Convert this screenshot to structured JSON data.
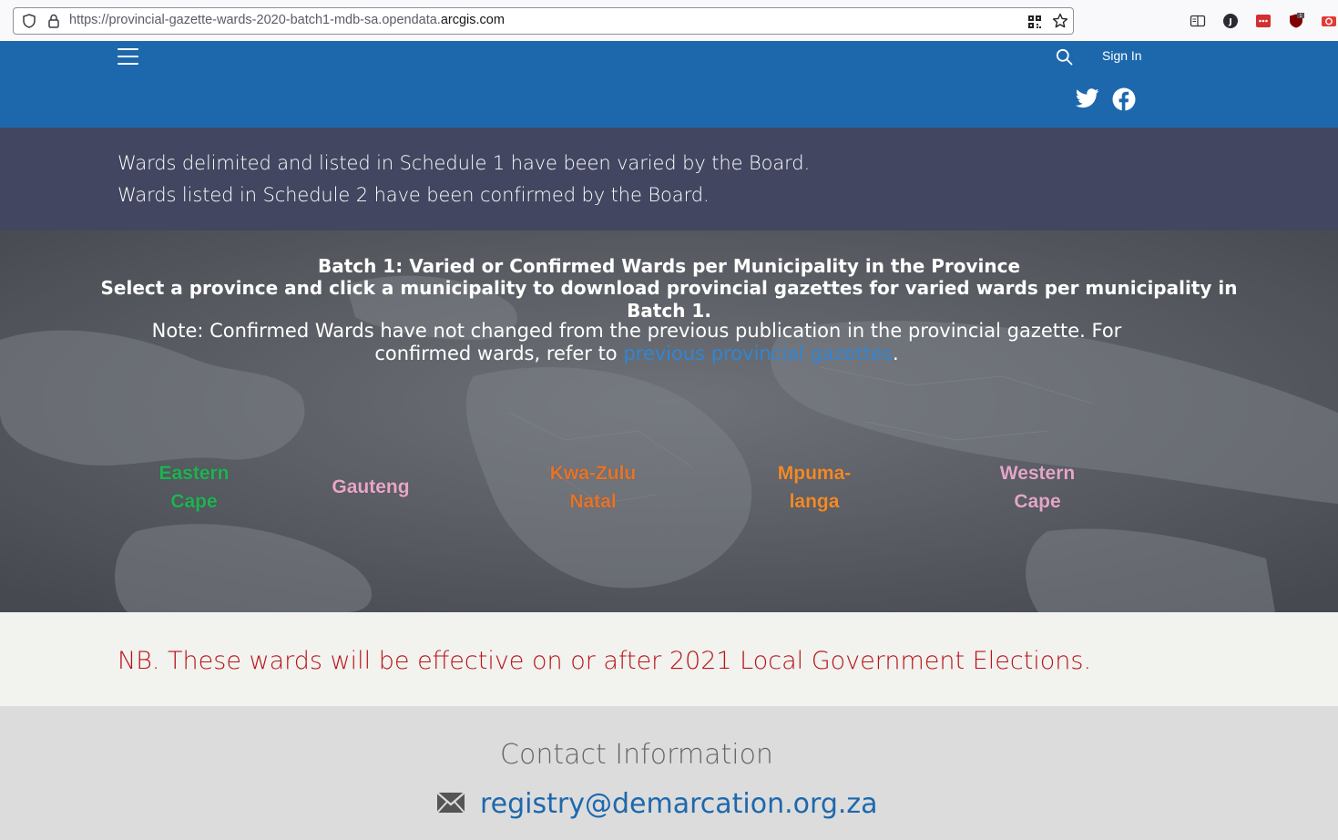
{
  "browser": {
    "url_prefix": "https://provincial-gazette-wards-2020-batch1-mdb-sa.opendata.",
    "url_domain": "arcgis.com"
  },
  "header": {
    "signin_label": "Sign In"
  },
  "info": {
    "line1": "Wards delimited and listed in Schedule 1 have been varied by the Board.",
    "line2": "Wards listed in Schedule 2 have been confirmed by the Board."
  },
  "map_section": {
    "title_line1": "Batch 1: Varied or Confirmed Wards per Municipality in the Province",
    "title_line2": "Select a province and click a municipality to download provincial gazettes for varied wards per municipality in",
    "title_line3": "Batch 1.",
    "note_prefix": "Note:  Confirmed Wards have not changed from the previous publication in the provincial gazette. For confirmed wards, refer to ",
    "note_link": "previous provincial gazettes",
    "note_suffix": ".",
    "link_color": "#2f86d6",
    "provinces": [
      {
        "line1": "Eastern",
        "line2": "Cape",
        "color": "#1fb254"
      },
      {
        "line1": "Gauteng",
        "line2": "",
        "color": "#e8a6c8"
      },
      {
        "line1": "Kwa-Zulu",
        "line2": "Natal",
        "color": "#e4742b"
      },
      {
        "line1": "Mpuma-",
        "line2": "langa",
        "color": "#f28a2a"
      },
      {
        "line1": "Western",
        "line2": "Cape",
        "color": "#e3a6c8"
      }
    ]
  },
  "nb": {
    "text": "NB. These wards will be effective on or after 2021 Local Government Elections.",
    "color": "#b8141b"
  },
  "contact": {
    "title": "Contact Information",
    "email": "registry@demarcation.org.za"
  },
  "colors": {
    "header_blue": "#1d68ad",
    "info_band": "#424660"
  }
}
